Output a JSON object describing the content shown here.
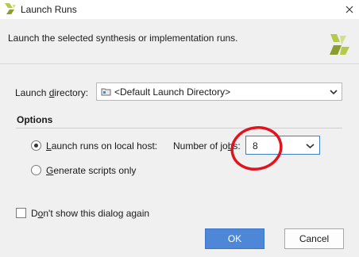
{
  "window": {
    "title": "Launch Runs",
    "description": "Launch the selected synthesis or implementation runs."
  },
  "launch_directory": {
    "label_pre": "Launch ",
    "label_mnemonic": "d",
    "label_post": "irectory:",
    "value": "<Default Launch Directory>"
  },
  "options": {
    "title": "Options",
    "local_host": {
      "label_mnemonic": "L",
      "label_post": "aunch runs on local host:",
      "selected": true
    },
    "jobs": {
      "label_pre": "Number of jo",
      "label_mnemonic": "b",
      "label_post": "s:",
      "value": "8"
    },
    "scripts": {
      "label_mnemonic": "G",
      "label_post": "enerate scripts only",
      "selected": false
    }
  },
  "dont_show": {
    "label_pre": "D",
    "label_mnemonic": "o",
    "label_post": "n't show this dialog again",
    "checked": false
  },
  "buttons": {
    "ok": "OK",
    "cancel": "Cancel"
  },
  "colors": {
    "accent": "#4e87d8",
    "annotation": "#e0141e",
    "logo": "#b7c94a"
  },
  "icons": {
    "app": "xilinx-logo-icon",
    "close": "close-icon",
    "folder": "folder-icon",
    "dropdown": "chevron-down-icon"
  }
}
